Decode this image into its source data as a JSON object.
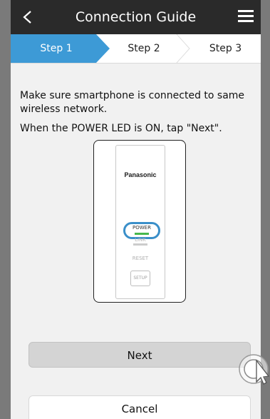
{
  "header": {
    "back_icon": "chevron-left-icon",
    "title": "Connection Guide",
    "menu_icon": "hamburger-menu-icon"
  },
  "steps": {
    "items": [
      {
        "label": "Step 1",
        "active": true
      },
      {
        "label": "Step 2",
        "active": false
      },
      {
        "label": "Step 3",
        "active": false
      }
    ],
    "active_color": "#3d9ad6"
  },
  "instructions": {
    "line1": "Make sure smartphone is connected to same wireless  network.",
    "line2": "When the POWER LED is ON, tap \"Next\"."
  },
  "device": {
    "brand": "Panasonic",
    "power_label": "POWER",
    "link_label": "LINK",
    "reset_label": "RESET",
    "setup_label": "SETUP",
    "highlight_color": "#3a8fc9",
    "power_led_color": "#47b84d"
  },
  "buttons": {
    "next": "Next",
    "cancel": "Cancel"
  }
}
